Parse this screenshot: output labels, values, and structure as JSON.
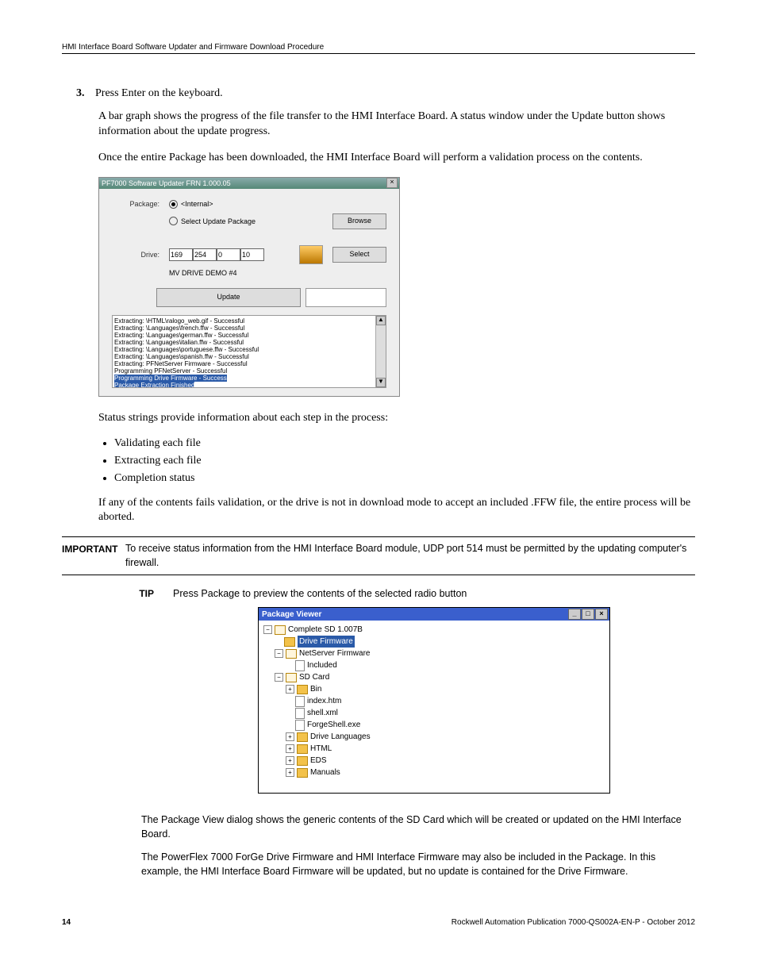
{
  "header": "HMI Interface Board Software Updater and Firmware Download Procedure",
  "step": {
    "num": "3.",
    "text": "Press Enter on the keyboard."
  },
  "p1": "A bar graph shows the progress of the file transfer to the HMI Interface Board. A status window under the Update button shows information about the update progress.",
  "p2": "Once the entire Package has been downloaded, the HMI Interface Board will perform a validation process on the contents.",
  "app": {
    "title": "PF7000 Software Updater FRN 1.000.05",
    "packageLabel": "Package:",
    "radioInternal": "<Internal>",
    "radioSelect": "Select Update Package",
    "browse": "Browse",
    "driveLabel": "Drive:",
    "ip": [
      "169",
      "254",
      "0",
      "10"
    ],
    "driveName": "MV DRIVE DEMO #4",
    "select": "Select",
    "update": "Update",
    "log": [
      "Extracting: \\HTML\\ralogo_web.gif - Successful",
      "Extracting: \\Languages\\french.ffw - Successful",
      "Extracting: \\Languages\\german.ffw - Successful",
      "Extracting: \\Languages\\italian.ffw - Successful",
      "Extracting: \\Languages\\portuguese.ffw - Successful",
      "Extracting: \\Languages\\spanish.ffw - Successful",
      "Extracting: PFNetServer Firmware - Successful",
      "Programming PFNetServer - Successful"
    ],
    "logHL1": "Programming Drive Firmware - Success",
    "logHL2": "Package Extraction Finished"
  },
  "p3": "Status strings provide information about each step in the process:",
  "bullets": [
    "Validating each file",
    "Extracting each file",
    "Completion status"
  ],
  "p4": "If any of the contents fails validation, or the drive is not in download mode to accept an included .FFW file, the entire process will be aborted.",
  "important": {
    "label": "IMPORTANT",
    "text": "To receive status information from the HMI Interface Board module, UDP port 514 must be permitted by the updating computer's firewall."
  },
  "tip": {
    "label": "TIP",
    "text": "Press Package to preview the contents of the selected radio button"
  },
  "pkg": {
    "title": "Package Viewer",
    "root": "Complete SD  1.007B",
    "driveFw": "Drive Firmware",
    "netServer": "NetServer Firmware",
    "included": "Included",
    "sdcard": "SD Card",
    "bin": "Bin",
    "index": "index.htm",
    "shell": "shell.xml",
    "forge": "ForgeShell.exe",
    "langs": "Drive Languages",
    "html": "HTML",
    "eds": "EDS",
    "manuals": "Manuals"
  },
  "after1": "The Package View dialog shows the generic contents of the SD Card which will be created or updated on the HMI Interface Board.",
  "after2": "The PowerFlex 7000 ForGe Drive Firmware and HMI Interface Firmware may also be included in the Package. In this example, the HMI Interface Board Firmware will be updated, but no update is contained for the Drive Firmware.",
  "footer": {
    "page": "14",
    "pub": "Rockwell Automation Publication 7000-QS002A-EN-P - October 2012"
  }
}
